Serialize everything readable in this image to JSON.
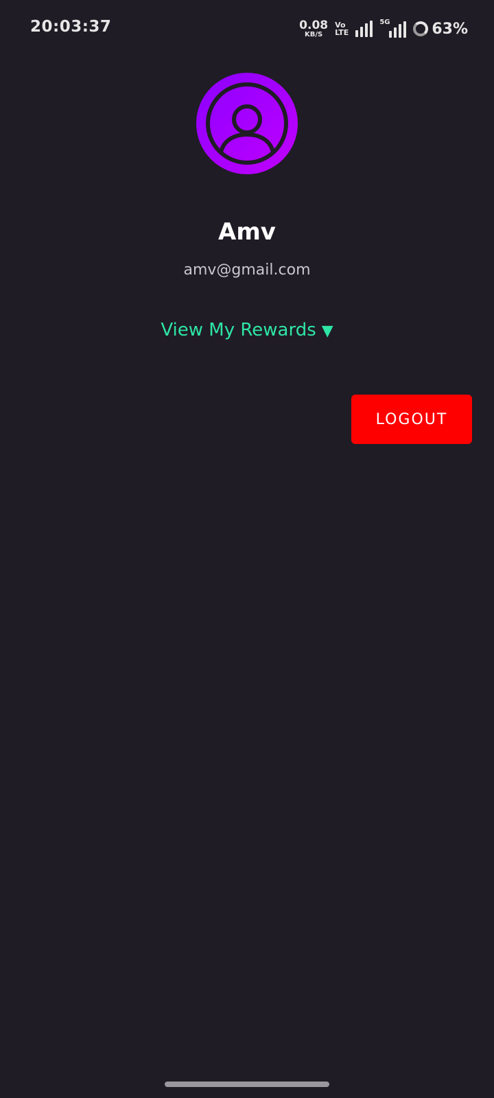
{
  "status_bar": {
    "time": "20:03:37",
    "net_speed_value": "0.08",
    "net_speed_unit": "KB/S",
    "volte_top": "Vo",
    "volte_bottom": "LTE",
    "network_5g": "5G",
    "battery_percent": "63%"
  },
  "profile": {
    "avatar_icon": "user-circle-icon",
    "name": "Amv",
    "email": "amv@gmail.com"
  },
  "rewards": {
    "label": "View My Rewards",
    "arrow": "▼"
  },
  "actions": {
    "logout_label": "LOGOUT"
  },
  "colors": {
    "background": "#1f1c25",
    "accent_green": "#2ee5a5",
    "logout_red": "#ff0000",
    "avatar_gradient_start": "#8b00ff",
    "avatar_gradient_end": "#c200ff"
  }
}
